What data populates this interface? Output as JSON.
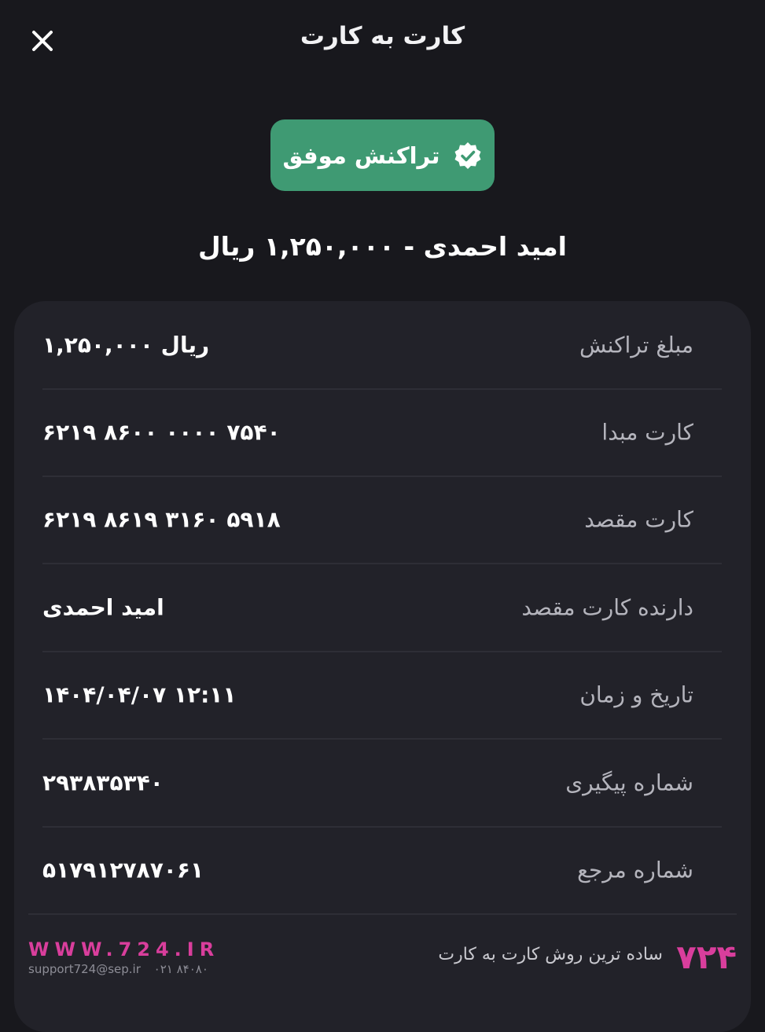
{
  "header": {
    "title": "کارت به کارت"
  },
  "status": {
    "label": "تراکنش موفق",
    "color": "#3f9a73"
  },
  "summary": "امید احمدی - ۱,۲۵۰,۰۰۰ ریال",
  "details": [
    {
      "label": "مبلغ تراکنش",
      "value": "۱,۲۵۰,۰۰۰ ریال"
    },
    {
      "label": "کارت مبدا",
      "value": "۶۲۱۹ ۸۶۰۰ ۰۰۰۰ ۷۵۴۰"
    },
    {
      "label": "کارت مقصد",
      "value": "۶۲۱۹ ۸۶۱۹ ۳۱۶۰ ۵۹۱۸"
    },
    {
      "label": "دارنده کارت مقصد",
      "value": "امید احمدی"
    },
    {
      "label": "تاریخ و زمان",
      "value": "۱۴۰۴/۰۴/۰۷ ۱۲:۱۱"
    },
    {
      "label": "شماره پیگیری",
      "value": "۲۹۳۸۳۵۳۴۰"
    },
    {
      "label": "شماره مرجع",
      "value": "۵۱۷۹۱۲۷۸۷۰۶۱"
    }
  ],
  "footer": {
    "site": "WWW.724.IR",
    "email": "support724@sep.ir",
    "phone": "۰۲۱ ۸۴۰۸۰",
    "tagline": "ساده ترین روش کارت به کارت",
    "logo": "۷۲۴",
    "brand_color": "#d93e9c"
  },
  "icons": {
    "close": "close-icon",
    "status": "verified-check-icon"
  }
}
